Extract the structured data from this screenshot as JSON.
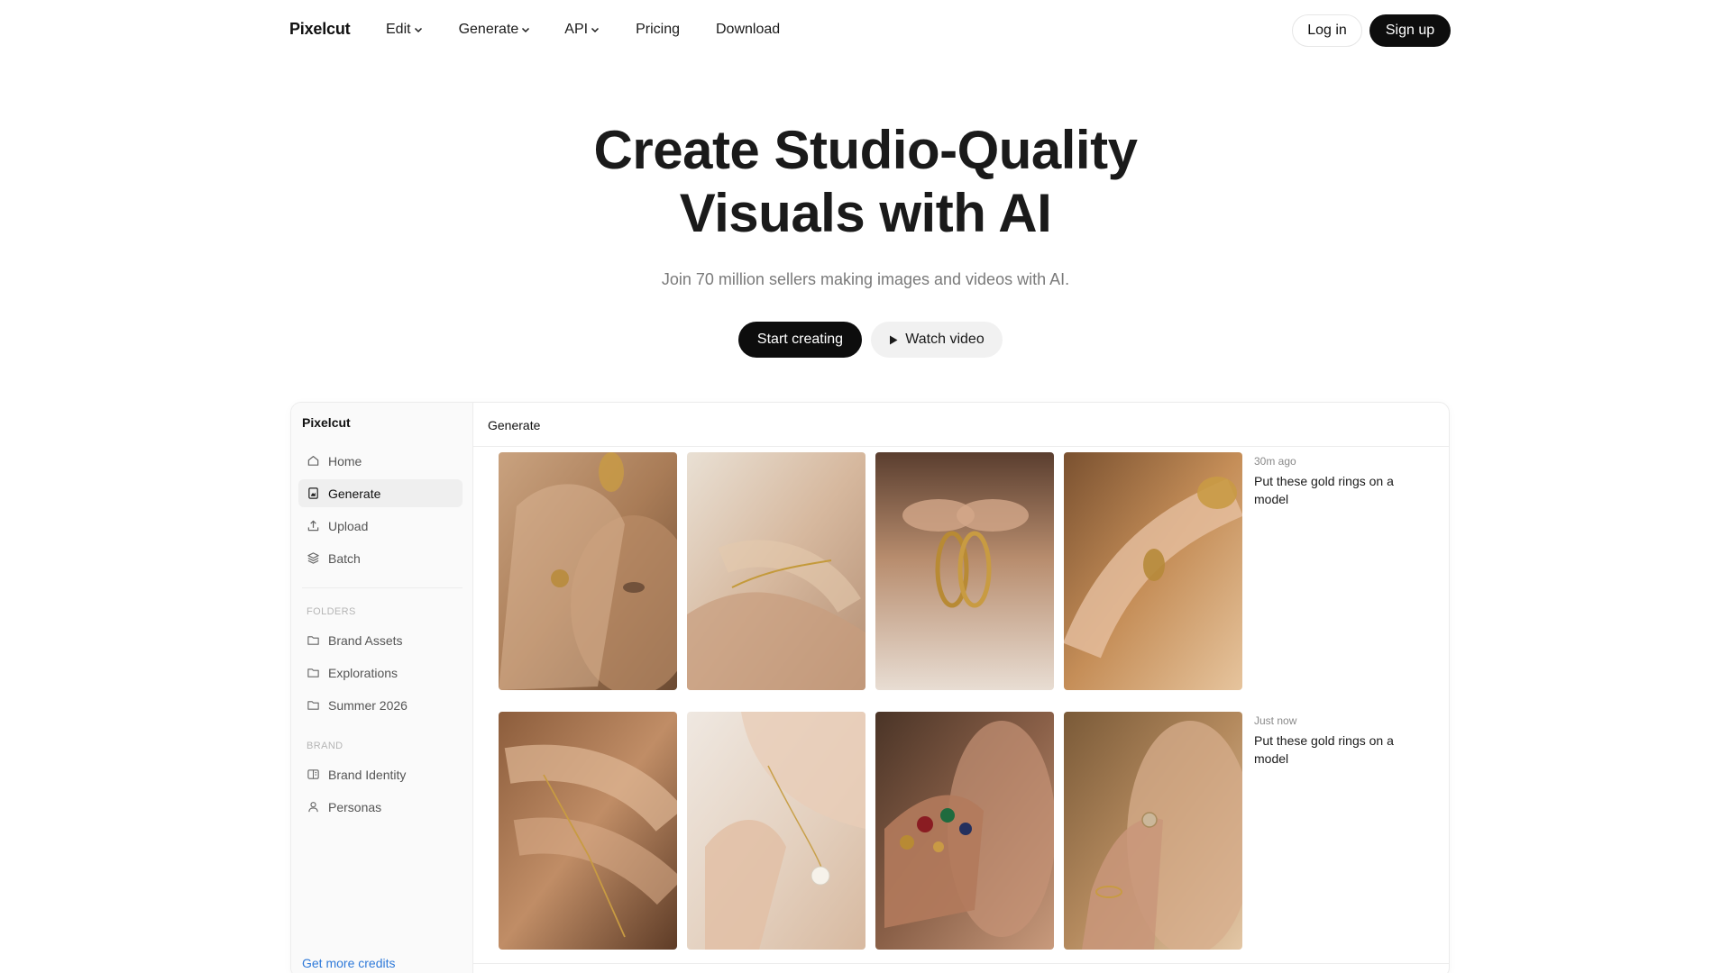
{
  "nav": {
    "brand": "Pixelcut",
    "links": [
      {
        "label": "Edit",
        "dropdown": true
      },
      {
        "label": "Generate",
        "dropdown": true
      },
      {
        "label": "API",
        "dropdown": true
      },
      {
        "label": "Pricing",
        "dropdown": false
      },
      {
        "label": "Download",
        "dropdown": false
      }
    ],
    "login_label": "Log in",
    "signup_label": "Sign up"
  },
  "hero": {
    "title_line1": "Create Studio-Quality",
    "title_line2": "Visuals with AI",
    "subtitle": "Join 70 million sellers making images and videos with AI.",
    "primary_cta": "Start creating",
    "secondary_cta": "Watch video"
  },
  "app": {
    "sidebar": {
      "brand": "Pixelcut",
      "main_items": [
        {
          "label": "Home",
          "icon": "home-icon",
          "active": false
        },
        {
          "label": "Generate",
          "icon": "generate-icon",
          "active": true
        },
        {
          "label": "Upload",
          "icon": "upload-icon",
          "active": false
        },
        {
          "label": "Batch",
          "icon": "layers-icon",
          "active": false
        }
      ],
      "folders_heading": "FOLDERS",
      "folders": [
        {
          "label": "Brand Assets",
          "icon": "folder-icon"
        },
        {
          "label": "Explorations",
          "icon": "folder-icon"
        },
        {
          "label": "Summer 2026",
          "icon": "folder-icon"
        }
      ],
      "brand_heading": "BRAND",
      "brand_items": [
        {
          "label": "Brand Identity",
          "icon": "brand-book-icon"
        },
        {
          "label": "Personas",
          "icon": "person-icon"
        }
      ],
      "credits_link": "Get more credits"
    },
    "main": {
      "title": "Generate",
      "rows": [
        {
          "time": "30m ago",
          "prompt": "Put these gold rings on a model"
        },
        {
          "time": "Just now",
          "prompt": "Put these gold rings on a model"
        }
      ]
    }
  },
  "colors": {
    "primary_button": "#0d0d0d",
    "link_blue": "#2f7ad9",
    "muted_text": "#7a7a7a"
  }
}
